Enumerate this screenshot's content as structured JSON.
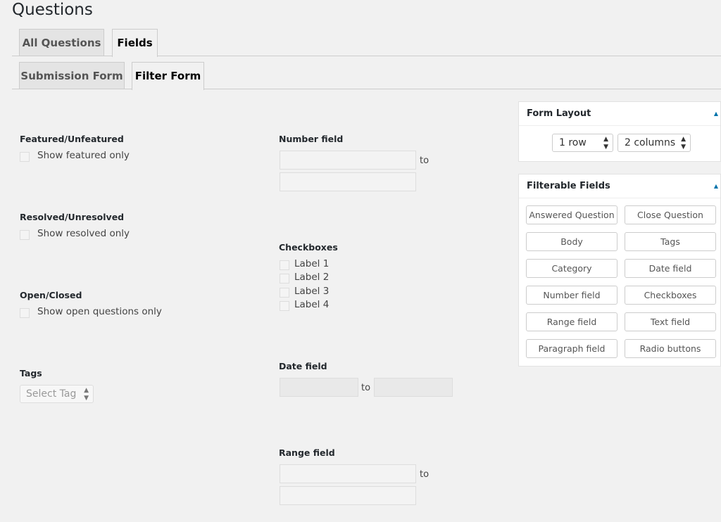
{
  "page": {
    "title": "Questions"
  },
  "tabs": [
    {
      "label": "All Questions"
    },
    {
      "label": "Fields"
    }
  ],
  "subtabs": [
    {
      "label": "Submission Form"
    },
    {
      "label": "Filter Form"
    }
  ],
  "form": {
    "featured": {
      "label": "Featured/Unfeatured",
      "option": "Show featured only"
    },
    "resolved": {
      "label": "Resolved/Unresolved",
      "option": "Show resolved only"
    },
    "open": {
      "label": "Open/Closed",
      "option": "Show open questions only"
    },
    "tags": {
      "label": "Tags",
      "select": "Select Tag"
    },
    "number": {
      "label": "Number field",
      "to": "to"
    },
    "checkboxes": {
      "label": "Checkboxes",
      "items": [
        "Label 1",
        "Label 2",
        "Label 3",
        "Label 4"
      ]
    },
    "date": {
      "label": "Date field",
      "to": "to"
    },
    "range": {
      "label": "Range field",
      "to": "to"
    }
  },
  "layout_panel": {
    "title": "Form Layout",
    "rows": "1 row",
    "columns": "2 columns"
  },
  "filterable_panel": {
    "title": "Filterable Fields",
    "buttons": [
      "Answered Question",
      "Close Question",
      "Body",
      "Tags",
      "Category",
      "Date field",
      "Number field",
      "Checkboxes",
      "Range field",
      "Text field",
      "Paragraph field",
      "Radio buttons"
    ]
  },
  "colors": {
    "accent": "#0073aa",
    "background": "#f1f1f1"
  }
}
